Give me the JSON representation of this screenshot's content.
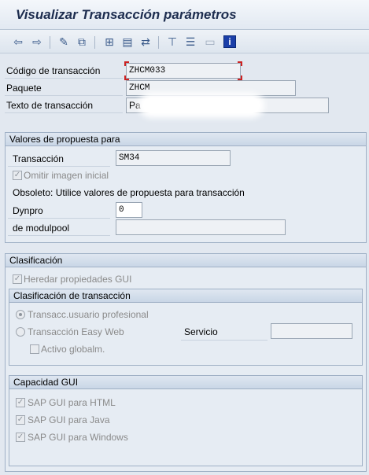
{
  "window": {
    "title": "Visualizar Transacción parámetros"
  },
  "toolbar": {
    "icons": [
      "back-arrow-icon",
      "forward-arrow-icon",
      "edit-pencil-icon",
      "other-object-icon",
      "tree-icon",
      "where-used-icon",
      "transport-icon",
      "hierarchy-icon",
      "layout-icon",
      "display-list-icon",
      "info-icon"
    ]
  },
  "header": {
    "code_label": "Código de transacción",
    "code_value": "ZHCM033",
    "package_label": "Paquete",
    "package_value": "ZHCM",
    "text_label": "Texto de transacción",
    "text_value": "Pa"
  },
  "defaults": {
    "title": "Valores de propuesta para",
    "transaction_label": "Transacción",
    "transaction_value": "SM34",
    "skip_initial_label": "Omitir imagen inicial",
    "obsolete_text": "Obsoleto: Utilice valores de propuesta para transacción",
    "dynpro_label": "Dynpro",
    "dynpro_value": "0",
    "modulpool_label": "de modulpool",
    "modulpool_value": ""
  },
  "classification": {
    "title": "Clasificación",
    "inherit_gui_label": "Heredar propiedades GUI",
    "tx_class": {
      "title": "Clasificación de transacción",
      "pro_user_label": "Transacc.usuario profesional",
      "easy_web_label": "Transacción Easy Web",
      "service_label": "Servicio",
      "service_value": "",
      "active_global_label": "Activo globalm."
    },
    "gui": {
      "title": "Capacidad GUI",
      "html_label": "SAP GUI para HTML",
      "java_label": "SAP GUI para Java",
      "windows_label": "SAP GUI para Windows"
    }
  },
  "colors": {
    "title": "#1d2d4f",
    "focus_marker": "#cc2222"
  }
}
